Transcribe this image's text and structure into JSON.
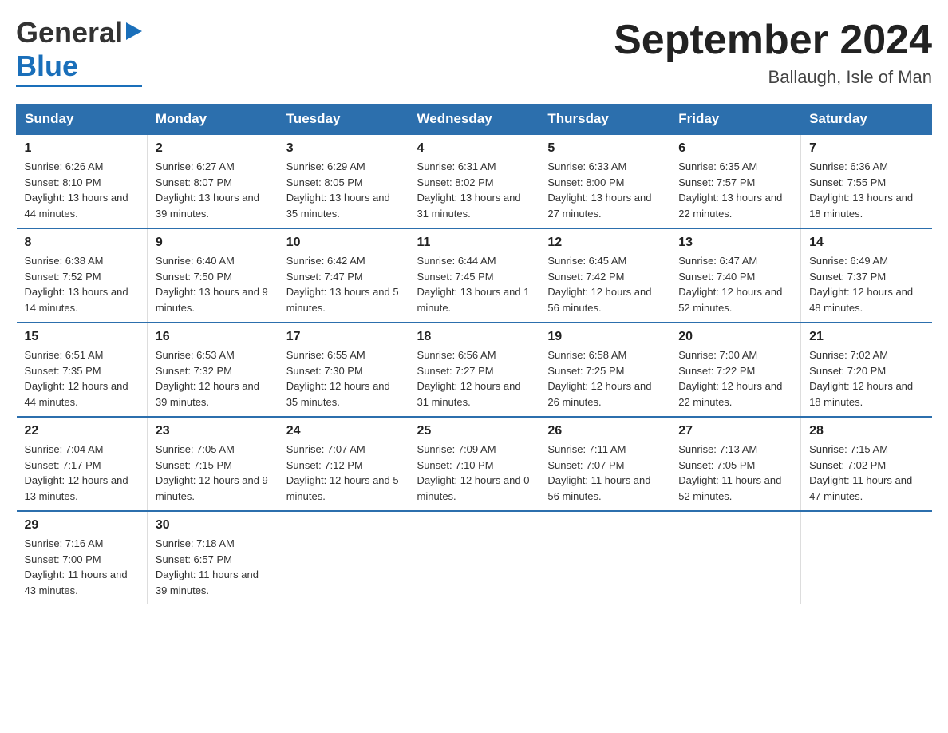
{
  "header": {
    "logo_line1": "General",
    "logo_line2": "Blue",
    "month_title": "September 2024",
    "location": "Ballaugh, Isle of Man"
  },
  "weekdays": [
    "Sunday",
    "Monday",
    "Tuesday",
    "Wednesday",
    "Thursday",
    "Friday",
    "Saturday"
  ],
  "weeks": [
    [
      {
        "day": "1",
        "sunrise": "6:26 AM",
        "sunset": "8:10 PM",
        "daylight": "13 hours and 44 minutes."
      },
      {
        "day": "2",
        "sunrise": "6:27 AM",
        "sunset": "8:07 PM",
        "daylight": "13 hours and 39 minutes."
      },
      {
        "day": "3",
        "sunrise": "6:29 AM",
        "sunset": "8:05 PM",
        "daylight": "13 hours and 35 minutes."
      },
      {
        "day": "4",
        "sunrise": "6:31 AM",
        "sunset": "8:02 PM",
        "daylight": "13 hours and 31 minutes."
      },
      {
        "day": "5",
        "sunrise": "6:33 AM",
        "sunset": "8:00 PM",
        "daylight": "13 hours and 27 minutes."
      },
      {
        "day": "6",
        "sunrise": "6:35 AM",
        "sunset": "7:57 PM",
        "daylight": "13 hours and 22 minutes."
      },
      {
        "day": "7",
        "sunrise": "6:36 AM",
        "sunset": "7:55 PM",
        "daylight": "13 hours and 18 minutes."
      }
    ],
    [
      {
        "day": "8",
        "sunrise": "6:38 AM",
        "sunset": "7:52 PM",
        "daylight": "13 hours and 14 minutes."
      },
      {
        "day": "9",
        "sunrise": "6:40 AM",
        "sunset": "7:50 PM",
        "daylight": "13 hours and 9 minutes."
      },
      {
        "day": "10",
        "sunrise": "6:42 AM",
        "sunset": "7:47 PM",
        "daylight": "13 hours and 5 minutes."
      },
      {
        "day": "11",
        "sunrise": "6:44 AM",
        "sunset": "7:45 PM",
        "daylight": "13 hours and 1 minute."
      },
      {
        "day": "12",
        "sunrise": "6:45 AM",
        "sunset": "7:42 PM",
        "daylight": "12 hours and 56 minutes."
      },
      {
        "day": "13",
        "sunrise": "6:47 AM",
        "sunset": "7:40 PM",
        "daylight": "12 hours and 52 minutes."
      },
      {
        "day": "14",
        "sunrise": "6:49 AM",
        "sunset": "7:37 PM",
        "daylight": "12 hours and 48 minutes."
      }
    ],
    [
      {
        "day": "15",
        "sunrise": "6:51 AM",
        "sunset": "7:35 PM",
        "daylight": "12 hours and 44 minutes."
      },
      {
        "day": "16",
        "sunrise": "6:53 AM",
        "sunset": "7:32 PM",
        "daylight": "12 hours and 39 minutes."
      },
      {
        "day": "17",
        "sunrise": "6:55 AM",
        "sunset": "7:30 PM",
        "daylight": "12 hours and 35 minutes."
      },
      {
        "day": "18",
        "sunrise": "6:56 AM",
        "sunset": "7:27 PM",
        "daylight": "12 hours and 31 minutes."
      },
      {
        "day": "19",
        "sunrise": "6:58 AM",
        "sunset": "7:25 PM",
        "daylight": "12 hours and 26 minutes."
      },
      {
        "day": "20",
        "sunrise": "7:00 AM",
        "sunset": "7:22 PM",
        "daylight": "12 hours and 22 minutes."
      },
      {
        "day": "21",
        "sunrise": "7:02 AM",
        "sunset": "7:20 PM",
        "daylight": "12 hours and 18 minutes."
      }
    ],
    [
      {
        "day": "22",
        "sunrise": "7:04 AM",
        "sunset": "7:17 PM",
        "daylight": "12 hours and 13 minutes."
      },
      {
        "day": "23",
        "sunrise": "7:05 AM",
        "sunset": "7:15 PM",
        "daylight": "12 hours and 9 minutes."
      },
      {
        "day": "24",
        "sunrise": "7:07 AM",
        "sunset": "7:12 PM",
        "daylight": "12 hours and 5 minutes."
      },
      {
        "day": "25",
        "sunrise": "7:09 AM",
        "sunset": "7:10 PM",
        "daylight": "12 hours and 0 minutes."
      },
      {
        "day": "26",
        "sunrise": "7:11 AM",
        "sunset": "7:07 PM",
        "daylight": "11 hours and 56 minutes."
      },
      {
        "day": "27",
        "sunrise": "7:13 AM",
        "sunset": "7:05 PM",
        "daylight": "11 hours and 52 minutes."
      },
      {
        "day": "28",
        "sunrise": "7:15 AM",
        "sunset": "7:02 PM",
        "daylight": "11 hours and 47 minutes."
      }
    ],
    [
      {
        "day": "29",
        "sunrise": "7:16 AM",
        "sunset": "7:00 PM",
        "daylight": "11 hours and 43 minutes."
      },
      {
        "day": "30",
        "sunrise": "7:18 AM",
        "sunset": "6:57 PM",
        "daylight": "11 hours and 39 minutes."
      },
      {
        "day": "",
        "sunrise": "",
        "sunset": "",
        "daylight": ""
      },
      {
        "day": "",
        "sunrise": "",
        "sunset": "",
        "daylight": ""
      },
      {
        "day": "",
        "sunrise": "",
        "sunset": "",
        "daylight": ""
      },
      {
        "day": "",
        "sunrise": "",
        "sunset": "",
        "daylight": ""
      },
      {
        "day": "",
        "sunrise": "",
        "sunset": "",
        "daylight": ""
      }
    ]
  ]
}
